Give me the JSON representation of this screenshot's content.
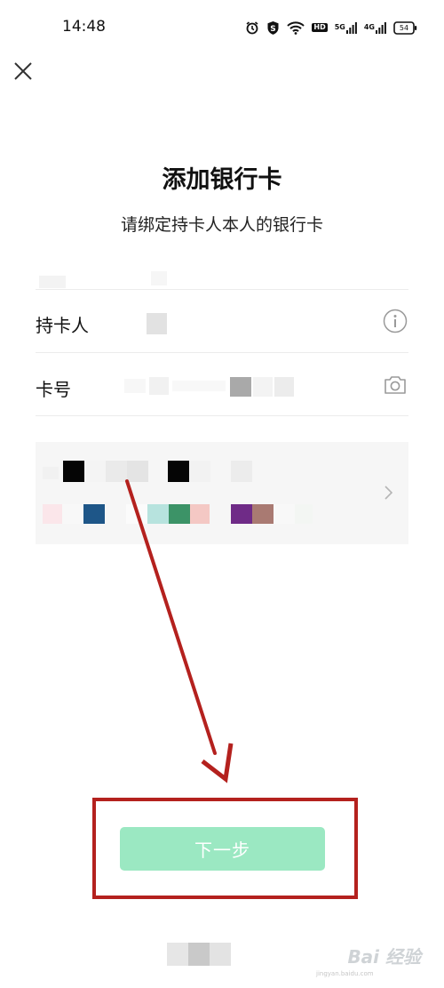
{
  "status_bar": {
    "time": "14:48",
    "network_5g": "5G",
    "network_4g": "4G",
    "hd_badge": "HD",
    "battery": "54",
    "icons": [
      "alarm-icon",
      "shield-s-icon",
      "wifi-icon",
      "hd-icon",
      "signal-5g-icon",
      "signal-4g-icon",
      "battery-icon"
    ]
  },
  "header": {
    "close_icon": "close-icon"
  },
  "title": "添加银行卡",
  "subtitle": "请绑定持卡人本人的银行卡",
  "form": {
    "holder_label": "持卡人",
    "holder_value_redacted": true,
    "holder_info_icon": "info-icon",
    "card_label": "卡号",
    "card_value_redacted": true,
    "card_scan_icon": "camera-icon"
  },
  "bank_panel": {
    "content_redacted": true,
    "chevron_icon": "chevron-right-icon"
  },
  "next_button": {
    "label": "下一步",
    "state": "disabled"
  },
  "annotation": {
    "color": "#b4211e"
  },
  "watermark": {
    "text": "Bai 经验",
    "sub": "jingyan.baidu.com"
  },
  "colors": {
    "accent": "#9be8c2",
    "divider": "#ececec",
    "panel_bg": "#f6f6f6",
    "annotation": "#b4211e"
  }
}
